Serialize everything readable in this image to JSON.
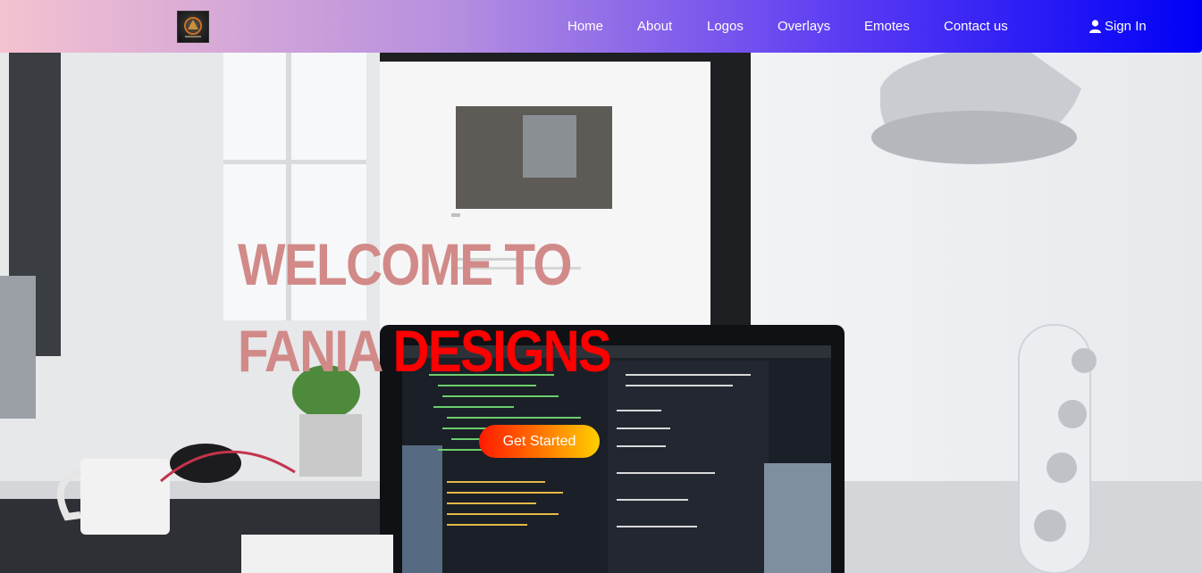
{
  "nav": {
    "logo_alt": "Fania Designs logo",
    "links": [
      "Home",
      "About",
      "Logos",
      "Overlays",
      "Emotes",
      "Contact us"
    ],
    "signin_label": "Sign In",
    "gradient": [
      "#f5c2cf",
      "#b58ee0",
      "#5c3cf3",
      "#0000f7"
    ]
  },
  "hero": {
    "line1": "WELCOME TO",
    "line2_prefix": "FANIA ",
    "line2_accent": "DESIGNS",
    "cta_label": "Get Started",
    "headline_color": "#d18a88",
    "accent_color": "#ff0000"
  },
  "icons": {
    "signin": "user-icon"
  }
}
